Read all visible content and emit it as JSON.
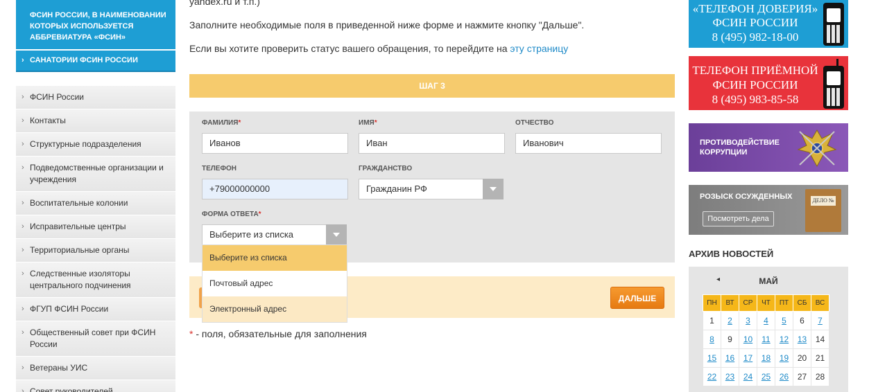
{
  "sidebar": {
    "top_item": "ФСИН РОССИИ, В НАИМЕНОВАНИИ КОТОРЫХ ИСПОЛЬЗУЕТСЯ АББРЕВИАТУРА «ФСИН»",
    "selected_item": "САНАТОРИИ ФСИН РОССИИ",
    "items": [
      "ФСИН России",
      "Контакты",
      "Структурные подразделения",
      "Подведомственные организации и учреждения",
      "Воспитательные колонии",
      "Исправительные центры",
      "Территориальные органы",
      "Следственные изоляторы центрального подчинения",
      "ФГУП ФСИН России",
      "Общественный совет при ФСИН России",
      "Ветераны УИС",
      "Совет руководителей"
    ]
  },
  "main": {
    "top_cut_text": "yandex.ru и т.п.)",
    "instruction": "Заполните необходимые поля в приведенной ниже форме и нажмите кнопку \"Дальше\".",
    "status_text": "Если вы хотите проверить статус вашего обращения, то перейдите на",
    "status_link": "эту страницу",
    "step_label": "ШАГ 3",
    "required_star": "*",
    "fields": {
      "surname": {
        "label": "ФАМИЛИЯ",
        "value": "Иванов"
      },
      "name": {
        "label": "ИМЯ",
        "value": "Иван"
      },
      "patronymic": {
        "label": "ОТЧЕСТВО",
        "value": "Иванович"
      },
      "phone": {
        "label": "ТЕЛЕФОН",
        "value": "+79000000000"
      },
      "citizenship": {
        "label": "ГРАЖДАНСТВО",
        "value": "Гражданин РФ"
      },
      "answer_form": {
        "label": "ФОРМА ОТВЕТА",
        "value": "Выберите из списка"
      }
    },
    "dropdown_options": [
      "Выберите из списка",
      "Почтовый адрес",
      "Электронный адрес"
    ],
    "next_button": "ДАЛЬШЕ",
    "required_note": " - поля, обязательные для заполнения"
  },
  "right": {
    "banner1": {
      "line1": "«ТЕЛЕФОН ДОВЕРИЯ»",
      "line2": "ФСИН РОССИИ",
      "line3": "8 (495) 982-18-00"
    },
    "banner2": {
      "line1": "ТЕЛЕФОН ПРИЁМНОЙ",
      "line2": "ФСИН РОССИИ",
      "line3": "8 (495) 983-85-58"
    },
    "banner3": {
      "line1": "ПРОТИВОДЕЙСТВИЕ",
      "line2": "КОРРУПЦИИ"
    },
    "banner4": {
      "title": "РОЗЫСК ОСУЖДЕННЫХ",
      "button": "Посмотреть дела",
      "folder_label": "ДЕЛО №"
    },
    "archive_title": "АРХИВ НОВОСТЕЙ",
    "calendar": {
      "prev_icon": "◂",
      "month": "МАЙ",
      "weekdays": [
        "ПН",
        "ВТ",
        "СР",
        "ЧТ",
        "ПТ",
        "СБ",
        "ВС"
      ],
      "weeks": [
        [
          "1",
          "2",
          "3",
          "4",
          "5",
          "6",
          "7"
        ],
        [
          "8",
          "9",
          "10",
          "11",
          "12",
          "13",
          "14"
        ],
        [
          "15",
          "16",
          "17",
          "18",
          "19",
          "20",
          "21"
        ],
        [
          "22",
          "23",
          "24",
          "25",
          "26",
          "27",
          "28"
        ]
      ],
      "linked_days": [
        "2",
        "3",
        "4",
        "5",
        "7",
        "8",
        "10",
        "11",
        "12",
        "13",
        "15",
        "16",
        "17",
        "18",
        "19",
        "22",
        "23",
        "24",
        "25",
        "26"
      ]
    }
  },
  "colors": {
    "accent_blue": "#1e9ed4",
    "step_yellow": "#f6cb6d",
    "button_orange": "#f28a20",
    "banner_red": "#e8333b",
    "banner_purple": "#7a4aaa",
    "link": "#1e8ac8"
  }
}
